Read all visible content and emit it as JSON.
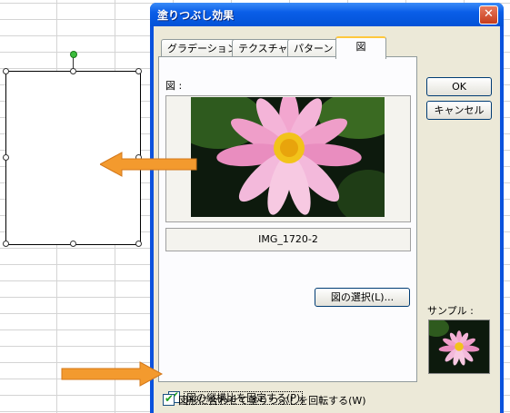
{
  "dialog": {
    "title": "塗りつぶし効果",
    "close_glyph": "✕",
    "tabs": [
      {
        "label": "グラデーション",
        "active": false
      },
      {
        "label": "テクスチャ",
        "active": false
      },
      {
        "label": "パターン",
        "active": false
      },
      {
        "label": "図",
        "active": true
      }
    ],
    "picture_label": "図 :",
    "filename": "IMG_1720-2",
    "select_picture_button": "図の選択(L)...",
    "ok_button": "OK",
    "cancel_button": "キャンセル",
    "sample_label": "サンプル :",
    "lock_aspect": {
      "label": "図の縦横比を固定する(P)",
      "checked": true
    },
    "rotate_with_shape": {
      "label": "図形に合わせて塗りつぶしを回転する(W)",
      "checked": true
    },
    "check_glyph": "✔"
  },
  "colors": {
    "titlebar": "#0a5ee8",
    "dialog_bg": "#ece9d8",
    "arrow": "#f39a2e",
    "rotation_handle": "#3cbd3c"
  },
  "icons": [
    "close-icon",
    "check-icon",
    "arrow-icon",
    "rotation-handle-icon"
  ]
}
